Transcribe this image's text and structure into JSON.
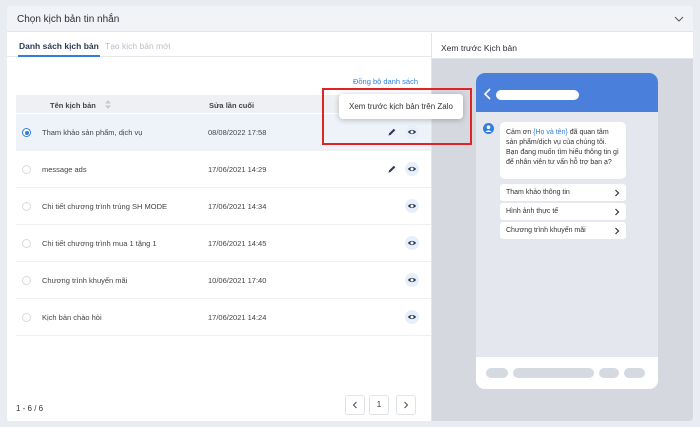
{
  "dialog": {
    "title": "Chọn kịch bản tin nhắn"
  },
  "tabs": [
    {
      "label": "Danh sách kịch bản",
      "active": true
    },
    {
      "label": "Tạo kịch bản mới",
      "active": false
    }
  ],
  "sync_link": "Đồng bộ danh sách",
  "table": {
    "headers": {
      "name": "Tên kịch bản",
      "date": "Sửa lần cuối"
    },
    "rows": [
      {
        "name": "Tham khảo sản phẩm, dịch vụ",
        "date": "08/08/2022 17:58",
        "selected": true,
        "editable": true
      },
      {
        "name": "message ads",
        "date": "17/06/2021 14:29",
        "selected": false,
        "editable": true
      },
      {
        "name": "Chi tiết chương trình trúng SH MODE",
        "date": "17/06/2021 14:34",
        "selected": false,
        "editable": false
      },
      {
        "name": "Chi tiết chương trình mua 1 tặng 1",
        "date": "17/06/2021 14:45",
        "selected": false,
        "editable": false
      },
      {
        "name": "Chương trình khuyến mãi",
        "date": "10/06/2021 17:40",
        "selected": false,
        "editable": false
      },
      {
        "name": "Kịch bản chào hỏi",
        "date": "17/06/2021 14:24",
        "selected": false,
        "editable": false
      }
    ]
  },
  "footer": {
    "count": "1 - 6 / 6",
    "page": "1"
  },
  "preview": {
    "title": "Xem trước Kịch bản",
    "message": {
      "part1": "Cảm ơn ",
      "variable": "{Họ và tên}",
      "part2": " đã quan tâm sản phẩm/dịch vụ của chúng tôi. Bạn đang muốn tìm hiểu thông tin gì để nhân viên tư vấn hỗ trợ bạn ạ?"
    },
    "quick_replies": [
      "Tham khảo thông tin",
      "Hình ảnh thực tế",
      "Chương trình khuyến mãi"
    ]
  },
  "tooltip": "Xem trước kịch bản trên Zalo",
  "colors": {
    "accent": "#2f7de1",
    "phone_header": "#4a80dc",
    "highlight": "#e02424"
  },
  "icons": [
    "chevron-down-icon",
    "sort-icon",
    "pencil-icon",
    "eye-icon",
    "chevron-left-icon",
    "chevron-right-icon",
    "bot-avatar-icon"
  ]
}
